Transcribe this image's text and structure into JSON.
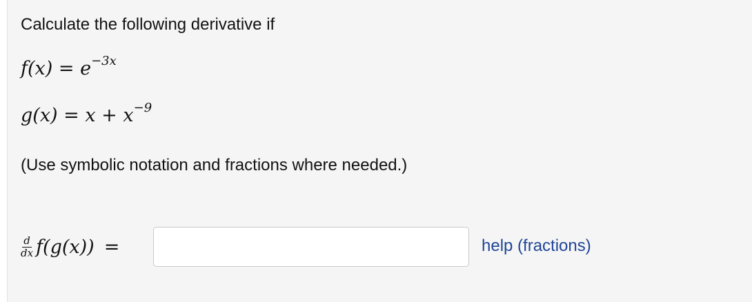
{
  "problem": {
    "prompt": "Calculate the following derivative if",
    "f": {
      "lhs": "f(x)",
      "eq": " = ",
      "base": "e",
      "exponent": "−3x"
    },
    "g": {
      "lhs": "g(x)",
      "eq": " = ",
      "expr_a": "x + x",
      "exponent": "−9"
    },
    "note": "(Use symbolic notation and fractions where needed.)",
    "derivative": {
      "numerator": "d",
      "denominator": "dx",
      "expr": "f(g(x))",
      "eq": "="
    }
  },
  "answer": {
    "value": "",
    "placeholder": ""
  },
  "help_link": {
    "label": "help (fractions)"
  }
}
